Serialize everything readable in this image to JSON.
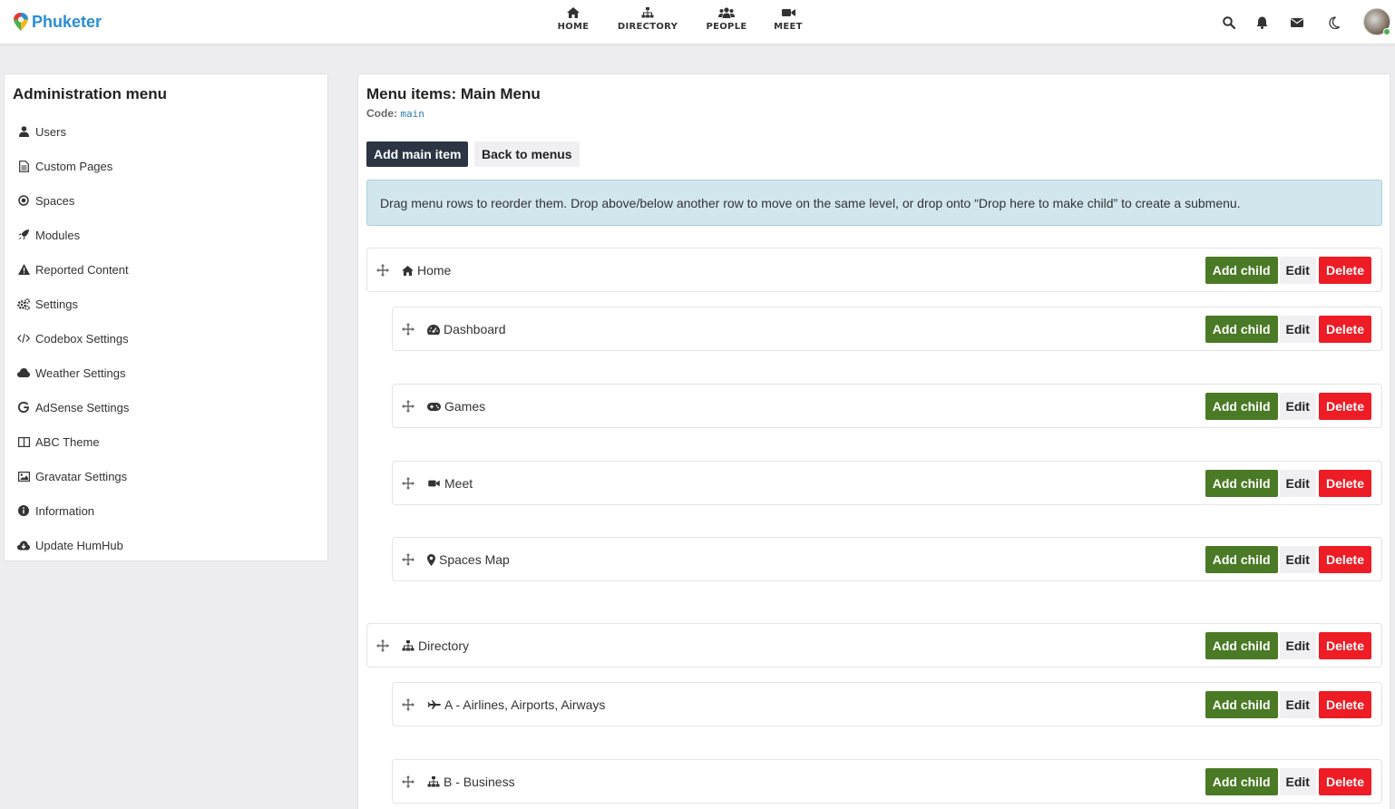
{
  "brand": {
    "name": "Phuketer",
    "colors": {
      "primary": "#2a8ed0",
      "green": "#4caf50",
      "yellow": "#f2b91e",
      "red": "#e53935"
    }
  },
  "topnav": [
    {
      "label": "HOME",
      "icon": "home-icon"
    },
    {
      "label": "DIRECTORY",
      "icon": "sitemap-icon"
    },
    {
      "label": "PEOPLE",
      "icon": "users-icon"
    },
    {
      "label": "MEET",
      "icon": "video-icon"
    }
  ],
  "topright": {
    "icons": [
      "search-icon",
      "bell-icon",
      "envelope-icon",
      "moon-icon"
    ],
    "avatar": "user-avatar"
  },
  "sidebar": {
    "title": "Administration menu",
    "items": [
      {
        "label": "Users",
        "icon": "user-icon"
      },
      {
        "label": "Custom Pages",
        "icon": "file-icon"
      },
      {
        "label": "Spaces",
        "icon": "dot-circle-icon"
      },
      {
        "label": "Modules",
        "icon": "rocket-icon"
      },
      {
        "label": "Reported Content",
        "icon": "warning-icon"
      },
      {
        "label": "Settings",
        "icon": "cogs-icon"
      },
      {
        "label": "Codebox Settings",
        "icon": "code-icon"
      },
      {
        "label": "Weather Settings",
        "icon": "cloud-icon"
      },
      {
        "label": "AdSense Settings",
        "icon": "google-icon"
      },
      {
        "label": "ABC Theme",
        "icon": "columns-icon"
      },
      {
        "label": "Gravatar Settings",
        "icon": "image-icon"
      },
      {
        "label": "Information",
        "icon": "info-icon"
      },
      {
        "label": "Update HumHub",
        "icon": "cloud-download-icon"
      }
    ]
  },
  "main": {
    "title": "Menu items: Main Menu",
    "code_label": "Code:",
    "code_value": "main",
    "add_main_label": "Add main item",
    "back_label": "Back to menus",
    "info_text": "Drag menu rows to reorder them. Drop above/below another row to move on the same level, or drop onto “Drop here to make child” to create a submenu.",
    "buttons": {
      "add_child": "Add child",
      "edit": "Edit",
      "delete": "Delete"
    },
    "button_colors": {
      "add_child": "#4a7a25",
      "delete": "#ee1c25",
      "dark": "#2b3543"
    },
    "rows": [
      {
        "label": "Home",
        "icon": "home-icon",
        "level": 0
      },
      {
        "label": "Dashboard",
        "icon": "tachometer-icon",
        "level": 1
      },
      {
        "label": "Games",
        "icon": "gamepad-icon",
        "level": 1
      },
      {
        "label": "Meet",
        "icon": "video-icon",
        "level": 1
      },
      {
        "label": "Spaces Map",
        "icon": "map-marker-icon",
        "level": 1
      },
      {
        "label": "Directory",
        "icon": "sitemap-icon",
        "level": 0
      },
      {
        "label": "A - Airlines, Airports, Airways",
        "icon": "plane-icon",
        "level": 1
      },
      {
        "label": "B - Business",
        "icon": "sitemap-icon",
        "level": 1
      }
    ]
  }
}
